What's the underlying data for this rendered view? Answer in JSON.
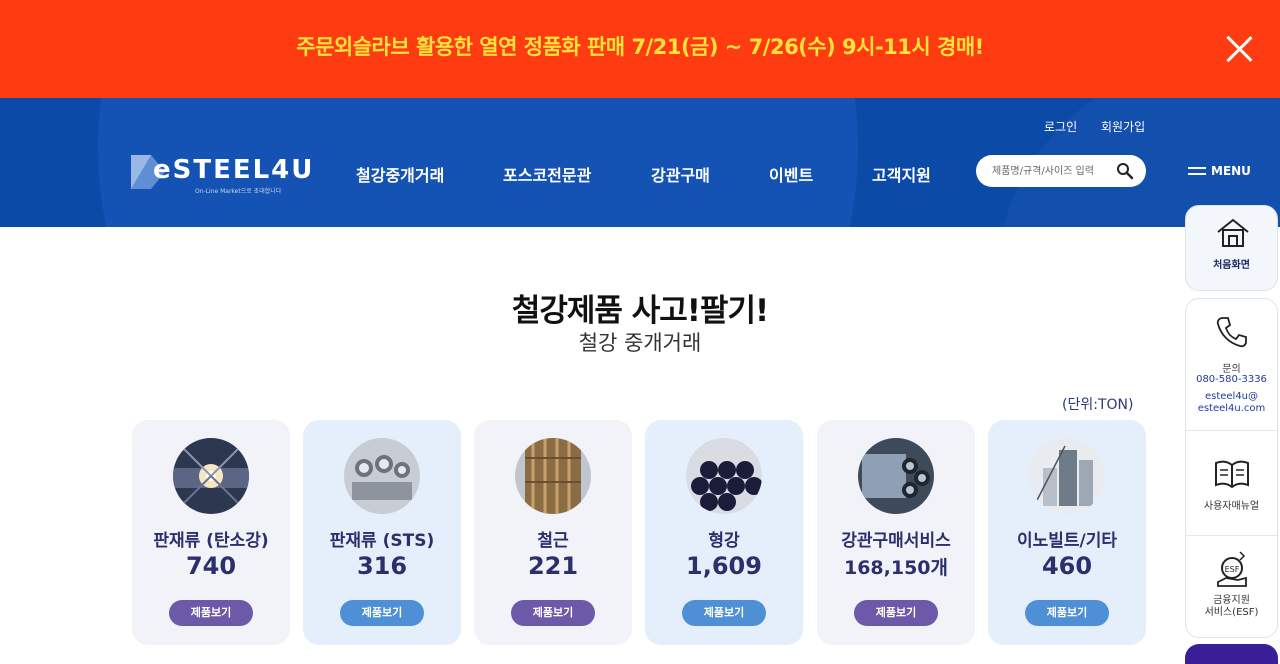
{
  "banner": {
    "text": "주문외슬라브 활용한 열연 정품화 판매 7/21(금) ~ 7/26(수) 9시-11시 경매!",
    "close_icon": "close-icon"
  },
  "header": {
    "top_links": [
      "로그인",
      "회원가입"
    ],
    "logo": {
      "text": "eSTEEL4U",
      "tagline": "On-Line Market으로 초대합니다"
    },
    "nav": [
      "철강중개거래",
      "포스코전문관",
      "강관구매",
      "이벤트",
      "고객지원"
    ],
    "search": {
      "placeholder": "제품명/규격/사이즈 입력",
      "icon": "search-icon"
    },
    "menu_label": "MENU"
  },
  "main": {
    "title": "철강제품 사고!팔기!",
    "subtitle": "철강 중개거래",
    "unit": "(단위:TON)",
    "cards": [
      {
        "name": "판재류 (탄소강)",
        "value": "740",
        "button": "제품보기"
      },
      {
        "name": "판재류 (STS)",
        "value": "316",
        "button": "제품보기"
      },
      {
        "name": "철근",
        "value": "221",
        "button": "제품보기"
      },
      {
        "name": "형강",
        "value": "1,609",
        "button": "제품보기"
      },
      {
        "name": "강관구매서비스",
        "value": "168,150개",
        "button": "제품보기"
      },
      {
        "name": "이노빌트/기타",
        "value": "460",
        "button": "제품보기"
      }
    ]
  },
  "sidebar": {
    "home_label": "처음화면",
    "contact_label": "문의",
    "phone": "080-580-3336",
    "email_line1": "esteel4u@",
    "email_line2": "esteel4u.com",
    "manual_label": "사용자매뉴얼",
    "finance_line1": "금융지원",
    "finance_line2": "서비스(ESF)"
  },
  "colors": {
    "banner_bg": "#ff3b12",
    "banner_text": "#ffe23b",
    "header_bg": "#0c4aa8",
    "card_text": "#2b2f6b",
    "button_purple": "#6c5aa8",
    "button_blue": "#4f8fd6"
  }
}
